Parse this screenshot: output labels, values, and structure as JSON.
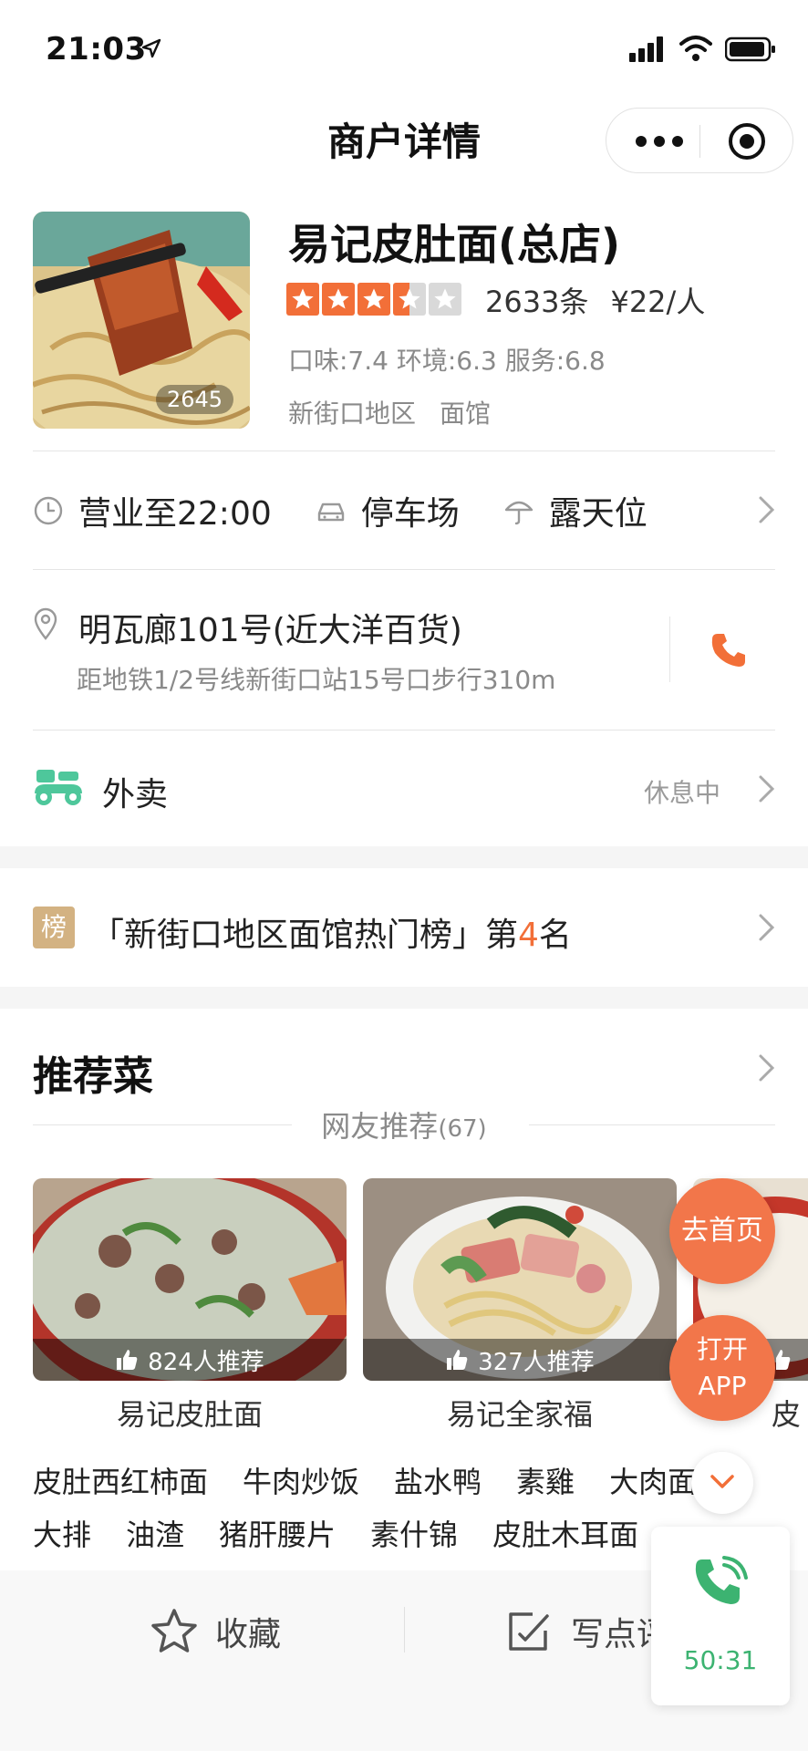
{
  "status_bar": {
    "time": "21:03"
  },
  "nav": {
    "title": "商户详情"
  },
  "shop": {
    "name": "易记皮肚面(总店)",
    "photo_count": "2645",
    "rating_stars": 3.5,
    "review_count": "2633条",
    "avg_price": "¥22/人",
    "scores": "口味:7.4 环境:6.3 服务:6.8",
    "region": "新街口地区",
    "category": "面馆"
  },
  "facilities": [
    {
      "icon": "clock-icon",
      "label": "营业至22:00"
    },
    {
      "icon": "car-icon",
      "label": "停车场"
    },
    {
      "icon": "umbrella-icon",
      "label": "露天位"
    }
  ],
  "address": {
    "line": "明瓦廊101号(近大洋百货)",
    "directions": "距地铁1/2号线新街口站15号口步行310m"
  },
  "takeout": {
    "label": "外卖",
    "status": "休息中"
  },
  "rank": {
    "badge": "榜",
    "prefix": "「新街口地区面馆热门榜」第",
    "number": "4",
    "suffix": "名"
  },
  "recommend": {
    "title": "推荐菜",
    "subtitle": "网友推荐",
    "subtitle_count": "(67)",
    "dishes": [
      {
        "name": "易记皮肚面",
        "likes": "824人推荐"
      },
      {
        "name": "易记全家福",
        "likes": "327人推荐"
      },
      {
        "name": "皮",
        "likes": ""
      }
    ],
    "tags_row1": [
      "皮肚西红柿面",
      "牛肉炒饭",
      "盐水鸭",
      "素雞",
      "大肉面"
    ],
    "tags_row2": [
      "大排",
      "油渣",
      "猪肝腰片",
      "素什锦",
      "皮肚木耳面"
    ]
  },
  "floating": {
    "home": "去首页",
    "open_app_1": "打开",
    "open_app_2": "APP"
  },
  "bottom_bar": {
    "favorite": "收藏",
    "write_review": "写点评"
  },
  "call": {
    "timer": "50:31"
  },
  "colors": {
    "accent": "#f26f38",
    "green": "#3cb371",
    "rank_gold": "#d3b282"
  }
}
